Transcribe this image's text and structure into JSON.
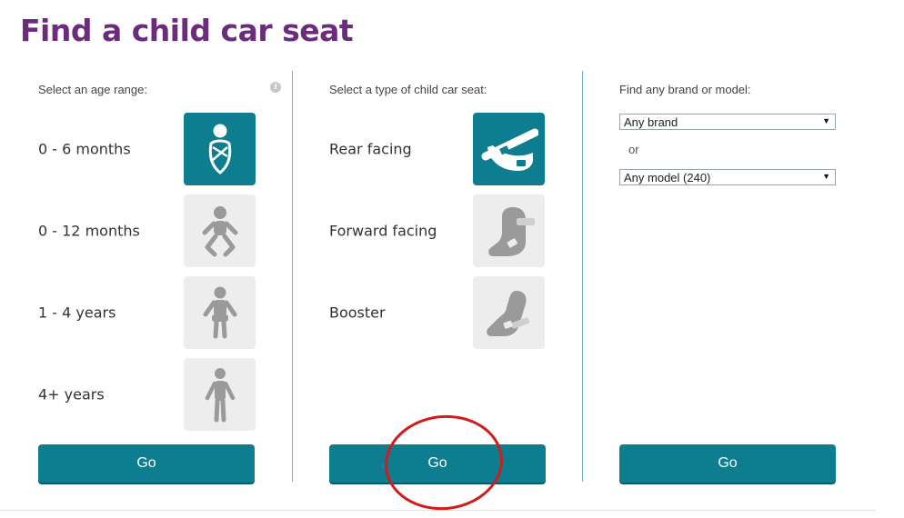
{
  "page": {
    "title": "Find a child car seat"
  },
  "age_column": {
    "label": "Select an age range:",
    "info_icon": "info-icon",
    "options": [
      {
        "label": "0 - 6 months",
        "icon": "swaddled-baby-icon",
        "selected": true
      },
      {
        "label": "0 - 12 months",
        "icon": "baby-icon",
        "selected": false
      },
      {
        "label": "1 - 4 years",
        "icon": "toddler-icon",
        "selected": false
      },
      {
        "label": "4+ years",
        "icon": "child-icon",
        "selected": false
      }
    ],
    "go_label": "Go"
  },
  "type_column": {
    "label": "Select a type of child car seat:",
    "options": [
      {
        "label": "Rear facing",
        "icon": "rear-facing-seat-icon",
        "selected": true
      },
      {
        "label": "Forward facing",
        "icon": "forward-facing-seat-icon",
        "selected": false
      },
      {
        "label": "Booster",
        "icon": "booster-seat-icon",
        "selected": false
      }
    ],
    "go_label": "Go"
  },
  "brand_column": {
    "label": "Find any brand or model:",
    "brand_select": {
      "value": "Any brand"
    },
    "or_text": "or",
    "model_select": {
      "value": "Any model (240)"
    },
    "go_label": "Go"
  },
  "colors": {
    "title": "#6b2d7b",
    "accent": "#0e7d90",
    "tile_inactive": "#ededed",
    "icon_inactive": "#9a9a9a",
    "highlight_ring": "#d11c1c"
  }
}
